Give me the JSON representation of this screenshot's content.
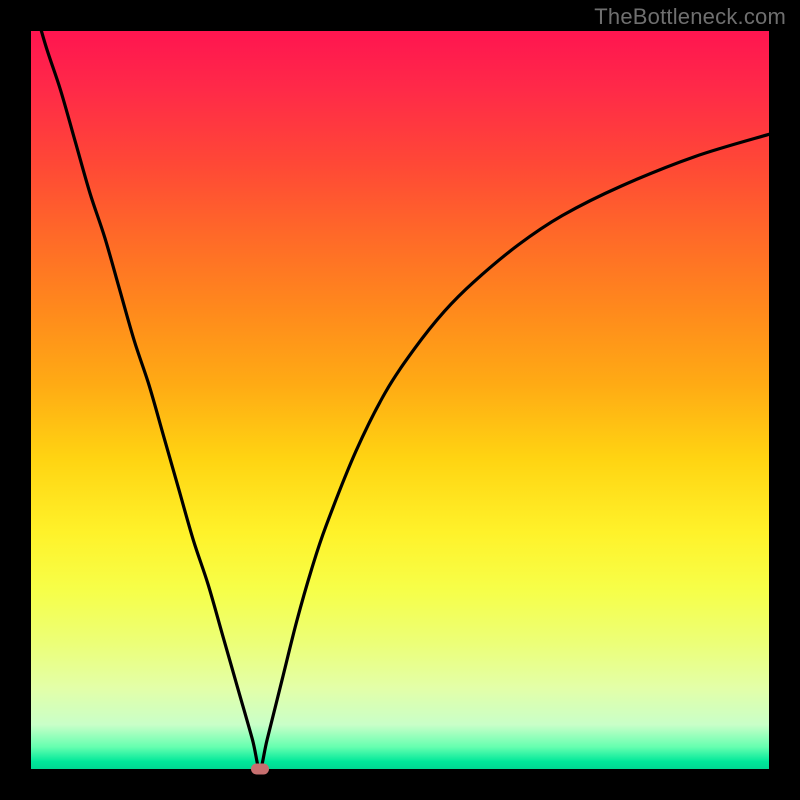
{
  "watermark": "TheBottleneck.com",
  "chart_data": {
    "type": "line",
    "title": "",
    "xlabel": "",
    "ylabel": "",
    "xlim": [
      0,
      100
    ],
    "ylim": [
      0,
      100
    ],
    "grid": false,
    "series": [
      {
        "name": "bottleneck-curve",
        "x": [
          0,
          2,
          4,
          6,
          8,
          10,
          12,
          14,
          16,
          18,
          20,
          22,
          24,
          26,
          28,
          30,
          31,
          32,
          34,
          36,
          38,
          40,
          44,
          48,
          52,
          56,
          60,
          66,
          72,
          80,
          90,
          100
        ],
        "y": [
          105,
          98,
          92,
          85,
          78,
          72,
          65,
          58,
          52,
          45,
          38,
          31,
          25,
          18,
          11,
          4,
          0,
          4,
          12,
          20,
          27,
          33,
          43,
          51,
          57,
          62,
          66,
          71,
          75,
          79,
          83,
          86
        ]
      }
    ],
    "annotations": [
      {
        "name": "optimum-marker",
        "x": 31,
        "y": 0
      }
    ],
    "gradient_stops": [
      {
        "pos": 0.0,
        "color": "#ff1550"
      },
      {
        "pos": 0.5,
        "color": "#ffd412"
      },
      {
        "pos": 0.98,
        "color": "#00e89a"
      }
    ]
  }
}
